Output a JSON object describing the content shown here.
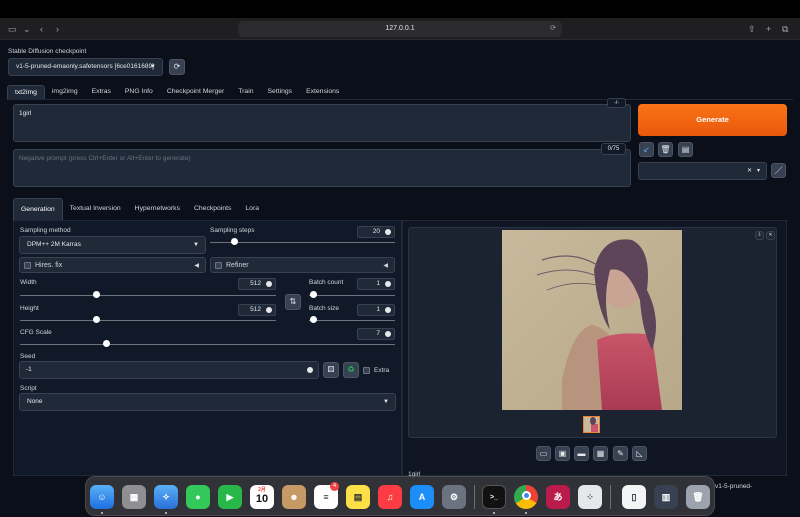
{
  "browser": {
    "url": "127.0.0.1",
    "tab_icons": "tabs-icon"
  },
  "checkpoint": {
    "label": "Stable Diffusion checkpoint",
    "value": "v1-5-pruned-emaonly.safetensors [6ce0161689]"
  },
  "main_tabs": [
    "txt2img",
    "img2img",
    "Extras",
    "PNG Info",
    "Checkpoint Merger",
    "Train",
    "Settings",
    "Extensions"
  ],
  "prompt": {
    "value": "1girl",
    "token_counter": "-/-",
    "negative_placeholder": "Negative prompt (press Ctrl+Enter or Alt+Enter to generate)",
    "negative_counter": "0/75"
  },
  "generate_label": "Generate",
  "sub_tabs": [
    "Generation",
    "Textual Inversion",
    "Hypernetworks",
    "Checkpoints",
    "Lora"
  ],
  "sampling": {
    "method_label": "Sampling method",
    "method_value": "DPM++ 2M Karras",
    "steps_label": "Sampling steps",
    "steps_value": "20",
    "steps_fraction": 0.13
  },
  "hires_label": "Hires. fix",
  "refiner_label": "Refiner",
  "width": {
    "label": "Width",
    "value": "512",
    "fraction": 0.3
  },
  "height": {
    "label": "Height",
    "value": "512",
    "fraction": 0.3
  },
  "batch_count": {
    "label": "Batch count",
    "value": "1",
    "fraction": 0.0
  },
  "batch_size": {
    "label": "Batch size",
    "value": "1",
    "fraction": 0.0
  },
  "cfg": {
    "label": "CFG Scale",
    "value": "7",
    "fraction": 0.23
  },
  "seed": {
    "label": "Seed",
    "value": "-1",
    "extra_label": "Extra"
  },
  "script": {
    "label": "Script",
    "value": "None"
  },
  "output": {
    "caption": "1girl",
    "caption_right": "v1-5-pruned-"
  },
  "dock_apps": [
    "finder",
    "launchpad",
    "safari",
    "messages",
    "facetime",
    "calendar",
    "contacts",
    "reminders",
    "notes",
    "music",
    "app-store",
    "system-settings",
    "terminal",
    "chrome",
    "kana",
    "launcher",
    "preview",
    "downloads",
    "trash"
  ],
  "calendar": {
    "month": "2月",
    "day": "10"
  },
  "reminders_badge": "4"
}
